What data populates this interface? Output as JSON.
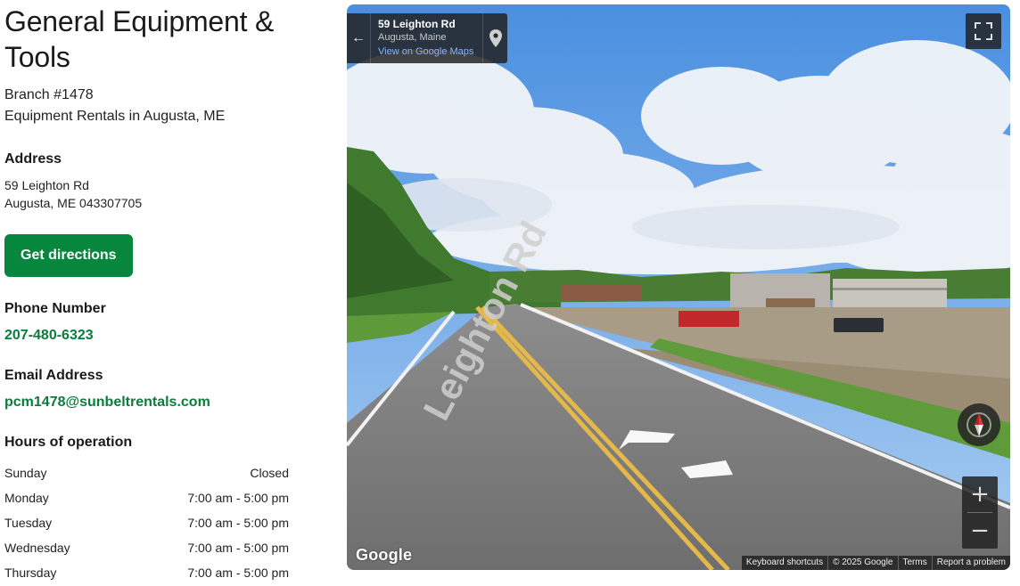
{
  "branch": {
    "title": "General Equipment & Tools",
    "number": "Branch #1478",
    "subtitle": "Equipment Rentals in Augusta, ME"
  },
  "address": {
    "heading": "Address",
    "line1": "59 Leighton Rd",
    "line2": "Augusta, ME 043307705",
    "directions_label": "Get directions"
  },
  "phone": {
    "heading": "Phone Number",
    "value": "207-480-6323"
  },
  "email": {
    "heading": "Email Address",
    "value": "pcm1478@sunbeltrentals.com"
  },
  "hours": {
    "heading": "Hours of operation",
    "rows": [
      {
        "day": "Sunday",
        "time": "Closed"
      },
      {
        "day": "Monday",
        "time": "7:00 am - 5:00 pm"
      },
      {
        "day": "Tuesday",
        "time": "7:00 am - 5:00 pm"
      },
      {
        "day": "Wednesday",
        "time": "7:00 am - 5:00 pm"
      },
      {
        "day": "Thursday",
        "time": "7:00 am - 5:00 pm"
      }
    ]
  },
  "map": {
    "card_title": "59 Leighton Rd",
    "card_city": "Augusta, Maine",
    "card_link": "View on Google Maps",
    "road_label": "Leighton Rd",
    "zoom_in": "+",
    "zoom_out": "−",
    "logo": "Google",
    "attribution": {
      "shortcuts": "Keyboard shortcuts",
      "copyright": "© 2025 Google",
      "terms": "Terms",
      "report": "Report a problem"
    },
    "icons": [
      "arrow-left-icon",
      "map-pin-icon",
      "fullscreen-icon",
      "compass-icon"
    ]
  },
  "colors": {
    "brand_green": "#06873d",
    "link_green": "#0a7d3b"
  }
}
